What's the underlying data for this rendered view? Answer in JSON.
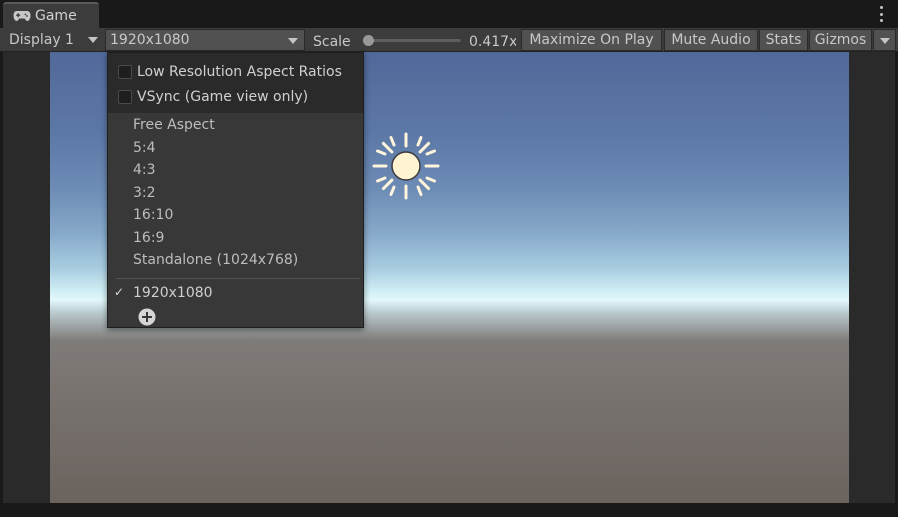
{
  "tab": {
    "icon": "gamepad-icon",
    "title": "Game"
  },
  "toolbar": {
    "display": "Display 1",
    "resolution": "1920x1080",
    "scale_label": "Scale",
    "scale_value": "0.417x",
    "maximize": "Maximize On Play",
    "mute": "Mute Audio",
    "stats": "Stats",
    "gizmos": "Gizmos"
  },
  "menu": {
    "checkboxes": [
      {
        "label": "Low Resolution Aspect Ratios",
        "checked": false
      },
      {
        "label": "VSync (Game view only)",
        "checked": false
      }
    ],
    "options": [
      "Free Aspect",
      "5:4",
      "4:3",
      "3:2",
      "16:10",
      "16:9",
      "Standalone (1024x768)"
    ],
    "selected": "1920x1080",
    "add_icon": "plus-circle-icon"
  },
  "colors": {
    "panel": "#3c3c3c",
    "button": "#515151",
    "menu": "#383838",
    "sky_top": "#51699a",
    "ground": "#6b635e"
  }
}
